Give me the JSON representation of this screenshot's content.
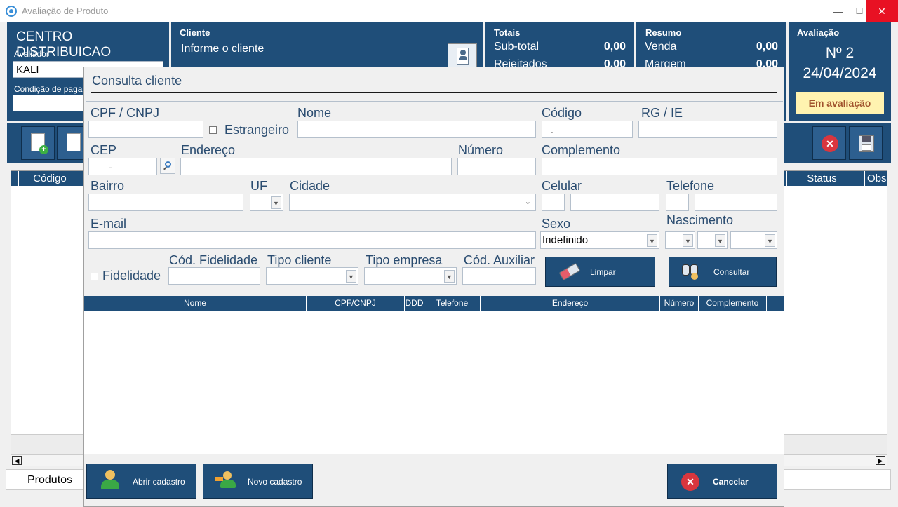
{
  "window": {
    "title": "Avaliação de Produto",
    "minimize": "—",
    "maximize": "☐",
    "close": "✕"
  },
  "header": {
    "store": "CENTRO DISTRIBUICAO",
    "avaliador_label": "Avaliador",
    "avaliador_value": "KALI",
    "condicao_label": "Condição de paga",
    "cliente_label": "Cliente",
    "cliente_value": "Informe o cliente",
    "totais_label": "Totais",
    "subtotal_label": "Sub-total",
    "subtotal_value": "0,00",
    "rejeitados_label": "Rejeitados",
    "rejeitados_value": "0,00",
    "resumo_label": "Resumo",
    "venda_label": "Venda",
    "venda_value": "0,00",
    "margem_label": "Margem",
    "margem_value": "0,00",
    "avaliacao_label": "Avaliação",
    "avaliacao_number": "Nº 2",
    "avaliacao_date": "24/04/2024",
    "status_badge": "Em avaliação"
  },
  "main_grid": {
    "col_codigo": "Código",
    "col_status": "Status",
    "col_obs": "Obse"
  },
  "bottom_tab": "Produtos",
  "dialog": {
    "title": "Consulta cliente",
    "cpf_label": "CPF / CNPJ",
    "estrangeiro_label": "Estrangeiro",
    "nome_label": "Nome",
    "codigo_label": "Código",
    "codigo_value": ".",
    "rg_label": "RG / IE",
    "cep_label": "CEP",
    "cep_value": "-",
    "endereco_label": "Endereço",
    "numero_label": "Número",
    "complemento_label": "Complemento",
    "bairro_label": "Bairro",
    "uf_label": "UF",
    "cidade_label": "Cidade",
    "celular_label": "Celular",
    "telefone_label": "Telefone",
    "email_label": "E-mail",
    "sexo_label": "Sexo",
    "sexo_value": "Indefinido",
    "nascimento_label": "Nascimento",
    "fidelidade_label": "Fidelidade",
    "cod_fidelidade_label": "Cód. Fidelidade",
    "tipo_cliente_label": "Tipo cliente",
    "tipo_empresa_label": "Tipo empresa",
    "cod_auxiliar_label": "Cód. Auxiliar",
    "limpar_label": "Limpar",
    "consultar_label": "Consultar",
    "columns": [
      "Nome",
      "CPF/CNPJ",
      "DDD",
      "Telefone",
      "Endereço",
      "Número",
      "Complemento"
    ],
    "abrir_cadastro_label": "Abrir cadastro",
    "novo_cadastro_label": "Novo cadastro",
    "cancelar_label": "Cancelar"
  }
}
